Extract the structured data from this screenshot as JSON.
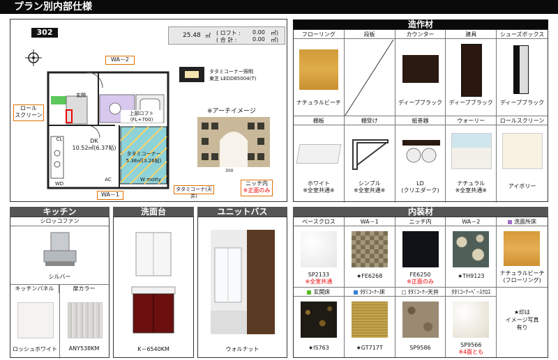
{
  "page_title": "プラン別内部仕様",
  "plan": {
    "room_number": "302",
    "area_value": "25.48",
    "area_unit": "㎡",
    "loft_label": "( ロフト :",
    "loft_value": "0.00",
    "loft_unit": "㎡)",
    "total_label": "( 合 計 :",
    "total_value": "0.00",
    "total_unit": "㎡)",
    "callout_wa2": "WA－2",
    "callout_wa1": "WA－1",
    "callout_roll": "ロール\nスクリーン",
    "callout_tatami": "タタミコーナ(天井)",
    "callout_niche": "ニッチ内",
    "callout_niche_note": "※正面のみ",
    "light_name": "タタミコーナー照明",
    "light_model": "東芝  LEDD85004(T)",
    "arch_title": "※アーチイメージ",
    "arch_dim": "300",
    "rooms": {
      "genkan": "玄関",
      "dk_line1": "DK",
      "dk_line2": "10.52㎡(6.37帖)",
      "tatami_line1": "上部ロフト",
      "tatami_line2": "(FL+700)",
      "tatami_line3": "タタミコーナー",
      "tatami_line4": "5.38㎡(3.26帖)",
      "cl": "CL",
      "ac": "AC",
      "ac2": "AC",
      "wmotty": "W motty",
      "wd": "WD"
    }
  },
  "zosaku": {
    "title": "造作材",
    "row1": [
      {
        "label": "フローリング",
        "caption": "ナチュラルビーチ"
      },
      {
        "label": "段板",
        "caption": ""
      },
      {
        "label": "カウンター",
        "caption": "ディープブラック"
      },
      {
        "label": "建具",
        "caption": "ディープブラック"
      },
      {
        "label": "シューズボックス",
        "caption": "ディープブラック"
      }
    ],
    "row2": [
      {
        "label": "棚板",
        "caption": "ホワイト",
        "note": "※全室共通※"
      },
      {
        "label": "棚受け",
        "caption": "シンプル",
        "note": "※全室共通※"
      },
      {
        "label": "紙巻器",
        "caption": "LD",
        "note": "(クリエダーク)"
      },
      {
        "label": "ウォーリー",
        "caption": "ナチュラル",
        "note": "※全室共通※"
      },
      {
        "label": "ロールスクリーン",
        "caption": "アイボリー",
        "note": ""
      }
    ]
  },
  "kitchen": {
    "title": "キッチン",
    "hood_label": "シロッコファン",
    "hood_caption": "シルバー",
    "panel_label": "キッチンパネル",
    "panel_caption": "ロッシュホワイト",
    "door_label": "扉カラー",
    "door_caption": "ANY538KM"
  },
  "vanity": {
    "title": "洗面台",
    "caption": "K－6540KM"
  },
  "bath": {
    "title": "ユニットバス",
    "caption": "ウォルナット"
  },
  "naiso": {
    "title": "内装材",
    "row1": [
      {
        "label": "ベースクロス",
        "caption": "SP2133",
        "note": "※全室共通"
      },
      {
        "label": "WA－1",
        "caption": "★FE6268",
        "note": ""
      },
      {
        "label": "ニッチ内",
        "caption": "FE6250",
        "note": "※正面のみ"
      },
      {
        "label": "WA－2",
        "caption": "★TH9123",
        "note": ""
      },
      {
        "label": "洗面所床",
        "caption": "ナチュラルビーチ",
        "note": "(フローリング)"
      }
    ],
    "row2": [
      {
        "label": "玄関床",
        "caption": "★IS763",
        "note": ""
      },
      {
        "label": "ﾀﾀﾐｺｰﾅｰ床",
        "caption": "★GT717T",
        "note": ""
      },
      {
        "label": "ﾀﾀﾐｺｰﾅｰ天井",
        "caption": "SP9586",
        "note": ""
      },
      {
        "label": "ﾀﾀﾐｺｰﾅｰﾍﾞｰｽｸﾛｽ",
        "caption": "SP9566",
        "note": "※4面とも"
      }
    ],
    "remark": "★印は\nイメージ写真\n有り",
    "colors": {
      "senmen": "#a070c8",
      "genkan": "#55bb22",
      "tatami_floor": "#3a7fd8",
      "tatami_ceiling": "#ffffff",
      "tatami_base": "#ffffff"
    }
  }
}
